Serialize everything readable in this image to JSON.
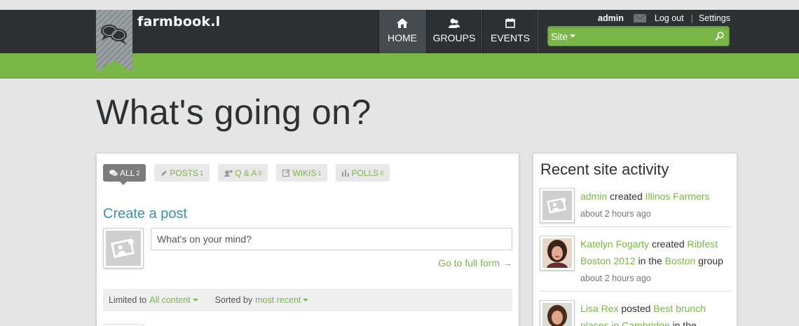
{
  "brand": {
    "name": "farmbook.l"
  },
  "nav": {
    "items": [
      {
        "label": "HOME",
        "icon": "home-icon"
      },
      {
        "label": "GROUPS",
        "icon": "groups-icon"
      },
      {
        "label": "EVENTS",
        "icon": "calendar-icon"
      }
    ]
  },
  "user": {
    "name": "admin",
    "logout": "Log out",
    "separator": "|",
    "settings": "Settings"
  },
  "search": {
    "scope": "Site",
    "placeholder": "",
    "icon": "search-icon"
  },
  "page": {
    "title": "What's going on?"
  },
  "filters": [
    {
      "label": "ALL",
      "count": "2",
      "icon": "comments-icon",
      "active": true
    },
    {
      "label": "POSTS",
      "count": "1",
      "icon": "pencil-icon",
      "active": false
    },
    {
      "label": "Q & A",
      "count": "0",
      "icon": "qa-icon",
      "active": false
    },
    {
      "label": "WIKIS",
      "count": "1",
      "icon": "edit-icon",
      "active": false
    },
    {
      "label": "POLLS",
      "count": "0",
      "icon": "bar-chart-icon",
      "active": false
    }
  ],
  "composer": {
    "title": "Create a post",
    "placeholder": "What's on your mind?",
    "full_form": "Go to full form →"
  },
  "sortbar": {
    "limited_prefix": "Limited to",
    "limited_value": "All content",
    "sorted_prefix": "Sorted by",
    "sorted_value": "most recent"
  },
  "activity": {
    "title": "Recent site activity",
    "items": [
      {
        "actor": "admin",
        "verb": "created",
        "object": "Illinos Farmers",
        "time": "about 2 hours ago",
        "avatar": "placeholder"
      },
      {
        "actor": "Katelyn Fogarty",
        "verb": "created",
        "object": "Ribfest Boston 2012",
        "in_text": "in the",
        "group": "Boston",
        "group_suffix": "group",
        "time": "about 2 hours ago",
        "avatar": "photo"
      },
      {
        "actor": "Lisa Rex",
        "verb": "posted",
        "object": "Best brunch places in Cambridge",
        "in_text": "in the",
        "avatar": "photo"
      }
    ]
  },
  "colors": {
    "accent": "#7ab648",
    "dark": "#2d3133",
    "link_blue": "#3b8fb0"
  }
}
